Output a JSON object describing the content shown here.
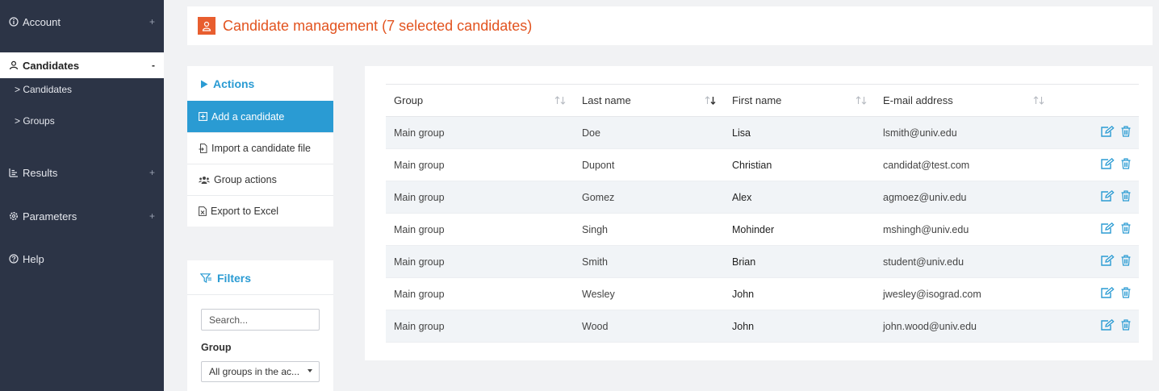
{
  "sidebar": {
    "items": [
      {
        "label": "Account",
        "toggle": "+",
        "icon": "info-icon"
      },
      {
        "label": "Candidates",
        "toggle": "-",
        "icon": "user-icon",
        "active": true
      },
      {
        "label": "Results",
        "toggle": "+",
        "icon": "bar-chart-icon"
      },
      {
        "label": "Parameters",
        "toggle": "+",
        "icon": "gear-icon"
      },
      {
        "label": "Help",
        "toggle": "",
        "icon": "help-icon"
      }
    ],
    "subitems": [
      "> Candidates",
      "> Groups"
    ]
  },
  "header": {
    "title": "Candidate management (7 selected candidates)",
    "icon": "user-icon",
    "accent": "#e2531f"
  },
  "actions": {
    "title": "Actions",
    "items": [
      "Add a candidate",
      "Import a candidate file",
      "Group actions",
      "Export to Excel"
    ]
  },
  "filters": {
    "title": "Filters",
    "search_placeholder": "Search...",
    "group_label": "Group",
    "group_value": "All groups in the ac..."
  },
  "table": {
    "columns": [
      "Group",
      "Last name",
      "First name",
      "E-mail address"
    ],
    "rows": [
      {
        "group": "Main group",
        "last": "Doe",
        "first": "Lisa",
        "email": "lsmith@univ.edu"
      },
      {
        "group": "Main group",
        "last": "Dupont",
        "first": "Christian",
        "email": "candidat@test.com"
      },
      {
        "group": "Main group",
        "last": "Gomez",
        "first": "Alex",
        "email": "agmoez@univ.edu"
      },
      {
        "group": "Main group",
        "last": "Singh",
        "first": "Mohinder",
        "email": "mshingh@univ.edu"
      },
      {
        "group": "Main group",
        "last": "Smith",
        "first": "Brian",
        "email": "student@univ.edu"
      },
      {
        "group": "Main group",
        "last": "Wesley",
        "first": "John",
        "email": "jwesley@isograd.com"
      },
      {
        "group": "Main group",
        "last": "Wood",
        "first": "John",
        "email": "john.wood@univ.edu"
      }
    ]
  },
  "colors": {
    "sidebar_bg": "#2c3446",
    "primary": "#2a9bd3",
    "accent": "#e2531f"
  }
}
